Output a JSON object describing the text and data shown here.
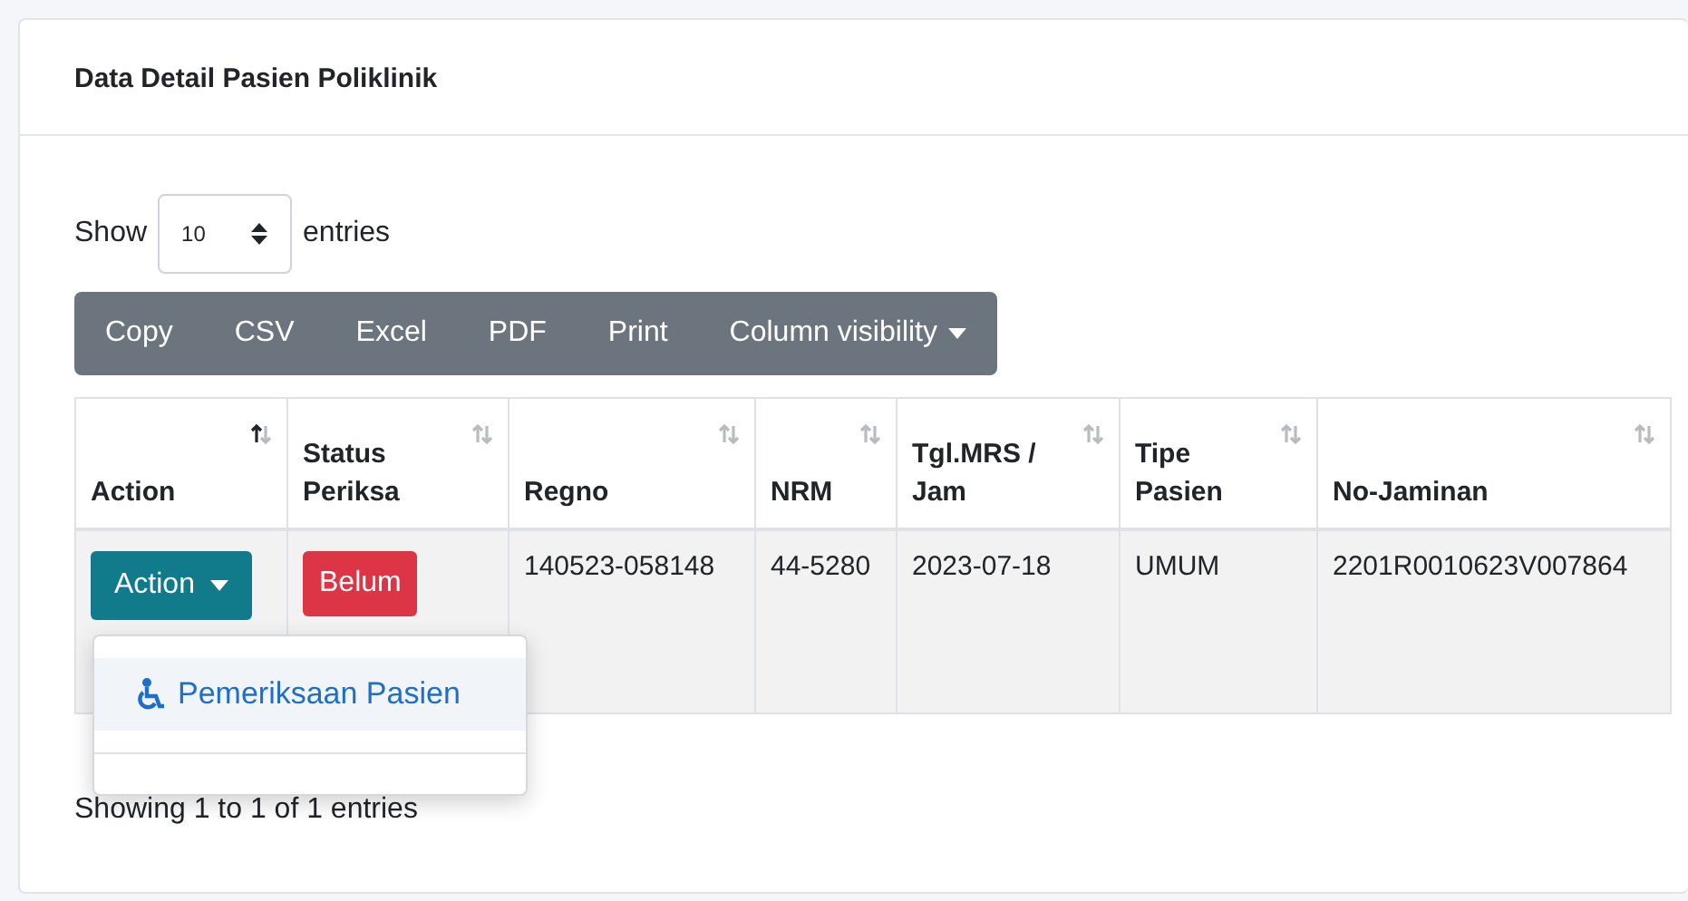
{
  "card": {
    "title": "Data Detail Pasien Poliklinik"
  },
  "length_menu": {
    "label_before": "Show",
    "value": "10",
    "label_after": "entries"
  },
  "export_buttons": [
    {
      "label": "Copy",
      "kind": "plain"
    },
    {
      "label": "CSV",
      "kind": "plain"
    },
    {
      "label": "Excel",
      "kind": "plain"
    },
    {
      "label": "PDF",
      "kind": "plain"
    },
    {
      "label": "Print",
      "kind": "plain"
    },
    {
      "label": "Column visibility",
      "kind": "dropdown"
    }
  ],
  "table": {
    "columns": [
      {
        "label": "Action",
        "sorted": true
      },
      {
        "label": "Status Periksa",
        "sorted": false
      },
      {
        "label": "Regno",
        "sorted": false
      },
      {
        "label": "NRM",
        "sorted": false
      },
      {
        "label": "Tgl.MRS / Jam",
        "sorted": false
      },
      {
        "label": "Tipe Pasien",
        "sorted": false
      },
      {
        "label": "No-Jaminan",
        "sorted": false
      }
    ],
    "rows": [
      {
        "cells": [
          {
            "kind": "button",
            "text": "Action"
          },
          {
            "kind": "badge",
            "text": "Belum"
          },
          {
            "kind": "text",
            "text": "140523-058148"
          },
          {
            "kind": "text",
            "text": "44-5280"
          },
          {
            "kind": "text",
            "text": "2023-07-18"
          },
          {
            "kind": "text",
            "text": "UMUM"
          },
          {
            "kind": "text",
            "text": "2201R0010623V007864"
          }
        ]
      }
    ]
  },
  "action_menu": {
    "open": true,
    "items": [
      {
        "label": "Pemeriksaan Pasien"
      }
    ]
  },
  "info": "Showing 1 to 1 of 1 entries"
}
